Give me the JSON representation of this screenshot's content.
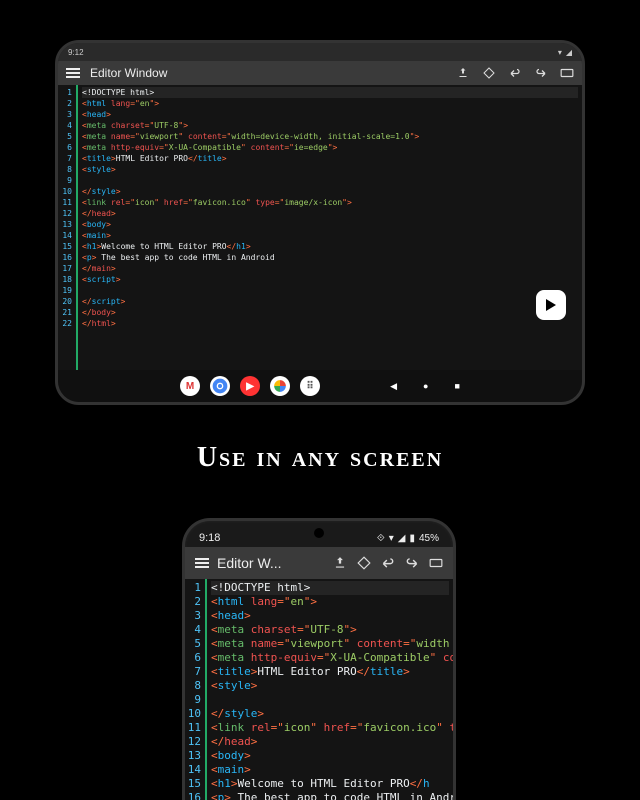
{
  "caption": "Use in any screen",
  "tablet": {
    "clock": "9:12",
    "title": "Editor Window",
    "lines": [
      [
        {
          "c": "t-doct",
          "t": "<!DOCTYPE html>"
        }
      ],
      [
        {
          "c": "t-br",
          "t": "<"
        },
        {
          "c": "t-tag",
          "t": "html"
        },
        {
          "c": "t-txt",
          "t": " "
        },
        {
          "c": "t-attr",
          "t": "lang"
        },
        {
          "c": "t-br",
          "t": "=\""
        },
        {
          "c": "t-str",
          "t": "en"
        },
        {
          "c": "t-br",
          "t": "\">"
        }
      ],
      [
        {
          "c": "t-br",
          "t": "<"
        },
        {
          "c": "t-tag",
          "t": "head"
        },
        {
          "c": "t-br",
          "t": ">"
        }
      ],
      [
        {
          "c": "t-br",
          "t": "<"
        },
        {
          "c": "t-tag2",
          "t": "meta"
        },
        {
          "c": "t-txt",
          "t": " "
        },
        {
          "c": "t-attr",
          "t": "charset"
        },
        {
          "c": "t-br",
          "t": "=\""
        },
        {
          "c": "t-str",
          "t": "UTF-8"
        },
        {
          "c": "t-br",
          "t": "\">"
        }
      ],
      [
        {
          "c": "t-br",
          "t": "<"
        },
        {
          "c": "t-tag2",
          "t": "meta"
        },
        {
          "c": "t-txt",
          "t": " "
        },
        {
          "c": "t-attr",
          "t": "name"
        },
        {
          "c": "t-br",
          "t": "=\""
        },
        {
          "c": "t-str",
          "t": "viewport"
        },
        {
          "c": "t-br",
          "t": "\" "
        },
        {
          "c": "t-attr",
          "t": "content"
        },
        {
          "c": "t-br",
          "t": "=\""
        },
        {
          "c": "t-str",
          "t": "width=device-width, initial-scale=1.0"
        },
        {
          "c": "t-br",
          "t": "\">"
        }
      ],
      [
        {
          "c": "t-br",
          "t": "<"
        },
        {
          "c": "t-tag2",
          "t": "meta"
        },
        {
          "c": "t-txt",
          "t": " "
        },
        {
          "c": "t-attr",
          "t": "http-equiv"
        },
        {
          "c": "t-br",
          "t": "=\""
        },
        {
          "c": "t-str",
          "t": "X-UA-Compatible"
        },
        {
          "c": "t-br",
          "t": "\" "
        },
        {
          "c": "t-attr",
          "t": "content"
        },
        {
          "c": "t-br",
          "t": "=\""
        },
        {
          "c": "t-str",
          "t": "ie=edge"
        },
        {
          "c": "t-br",
          "t": "\">"
        }
      ],
      [
        {
          "c": "t-br",
          "t": "<"
        },
        {
          "c": "t-tag",
          "t": "title"
        },
        {
          "c": "t-br",
          "t": ">"
        },
        {
          "c": "t-txt",
          "t": "HTML Editor PRO"
        },
        {
          "c": "t-br",
          "t": "</"
        },
        {
          "c": "t-tag",
          "t": "title"
        },
        {
          "c": "t-br",
          "t": ">"
        }
      ],
      [
        {
          "c": "t-br",
          "t": "<"
        },
        {
          "c": "t-tag",
          "t": "style"
        },
        {
          "c": "t-br",
          "t": ">"
        }
      ],
      [
        {
          "c": "t-txt",
          "t": ""
        }
      ],
      [
        {
          "c": "t-br",
          "t": "</"
        },
        {
          "c": "t-tag",
          "t": "style"
        },
        {
          "c": "t-br",
          "t": ">"
        }
      ],
      [
        {
          "c": "t-br",
          "t": "<"
        },
        {
          "c": "t-tag2",
          "t": "link"
        },
        {
          "c": "t-txt",
          "t": " "
        },
        {
          "c": "t-attr",
          "t": "rel"
        },
        {
          "c": "t-br",
          "t": "=\""
        },
        {
          "c": "t-str",
          "t": "icon"
        },
        {
          "c": "t-br",
          "t": "\" "
        },
        {
          "c": "t-attr",
          "t": "href"
        },
        {
          "c": "t-br",
          "t": "=\""
        },
        {
          "c": "t-str",
          "t": "favicon.ico"
        },
        {
          "c": "t-br",
          "t": "\" "
        },
        {
          "c": "t-attr",
          "t": "type"
        },
        {
          "c": "t-br",
          "t": "=\""
        },
        {
          "c": "t-str",
          "t": "image/x-icon"
        },
        {
          "c": "t-br",
          "t": "\">"
        }
      ],
      [
        {
          "c": "t-br",
          "t": "</"
        },
        {
          "c": "t-close",
          "t": "head"
        },
        {
          "c": "t-br",
          "t": ">"
        }
      ],
      [
        {
          "c": "t-br",
          "t": "<"
        },
        {
          "c": "t-tag",
          "t": "body"
        },
        {
          "c": "t-br",
          "t": ">"
        }
      ],
      [
        {
          "c": "t-br",
          "t": "<"
        },
        {
          "c": "t-tag",
          "t": "main"
        },
        {
          "c": "t-br",
          "t": ">"
        }
      ],
      [
        {
          "c": "t-br",
          "t": "<"
        },
        {
          "c": "t-tag",
          "t": "h1"
        },
        {
          "c": "t-br",
          "t": ">"
        },
        {
          "c": "t-txt",
          "t": "Welcome to HTML Editor PRO"
        },
        {
          "c": "t-br",
          "t": "</"
        },
        {
          "c": "t-tag",
          "t": "h1"
        },
        {
          "c": "t-br",
          "t": ">"
        }
      ],
      [
        {
          "c": "t-br",
          "t": "<"
        },
        {
          "c": "t-tag",
          "t": "p"
        },
        {
          "c": "t-br",
          "t": "> "
        },
        {
          "c": "t-txt",
          "t": "The best app to code HTML in Android"
        }
      ],
      [
        {
          "c": "t-br",
          "t": "</"
        },
        {
          "c": "t-close",
          "t": "main"
        },
        {
          "c": "t-br",
          "t": ">"
        }
      ],
      [
        {
          "c": "t-br",
          "t": "<"
        },
        {
          "c": "t-tag",
          "t": "script"
        },
        {
          "c": "t-br",
          "t": ">"
        }
      ],
      [
        {
          "c": "t-txt",
          "t": ""
        }
      ],
      [
        {
          "c": "t-br",
          "t": "</"
        },
        {
          "c": "t-tag",
          "t": "script"
        },
        {
          "c": "t-br",
          "t": ">"
        }
      ],
      [
        {
          "c": "t-br",
          "t": "</"
        },
        {
          "c": "t-close",
          "t": "body"
        },
        {
          "c": "t-br",
          "t": ">"
        }
      ],
      [
        {
          "c": "t-br",
          "t": "</"
        },
        {
          "c": "t-close",
          "t": "html"
        },
        {
          "c": "t-br",
          "t": ">"
        }
      ]
    ],
    "highlight_line": 0
  },
  "phone": {
    "clock": "9:18",
    "battery": "45%",
    "title": "Editor W...",
    "lines": [
      [
        {
          "c": "t-doct",
          "t": "<!DOCTYPE html>"
        }
      ],
      [
        {
          "c": "t-br",
          "t": "<"
        },
        {
          "c": "t-tag",
          "t": "html"
        },
        {
          "c": "t-txt",
          "t": " "
        },
        {
          "c": "t-attr",
          "t": "lang"
        },
        {
          "c": "t-br",
          "t": "=\""
        },
        {
          "c": "t-str",
          "t": "en"
        },
        {
          "c": "t-br",
          "t": "\">"
        }
      ],
      [
        {
          "c": "t-br",
          "t": "<"
        },
        {
          "c": "t-tag",
          "t": "head"
        },
        {
          "c": "t-br",
          "t": ">"
        }
      ],
      [
        {
          "c": "t-br",
          "t": "<"
        },
        {
          "c": "t-tag2",
          "t": "meta"
        },
        {
          "c": "t-txt",
          "t": " "
        },
        {
          "c": "t-attr",
          "t": "charset"
        },
        {
          "c": "t-br",
          "t": "=\""
        },
        {
          "c": "t-str",
          "t": "UTF-8"
        },
        {
          "c": "t-br",
          "t": "\">"
        }
      ],
      [
        {
          "c": "t-br",
          "t": "<"
        },
        {
          "c": "t-tag2",
          "t": "meta"
        },
        {
          "c": "t-txt",
          "t": " "
        },
        {
          "c": "t-attr",
          "t": "name"
        },
        {
          "c": "t-br",
          "t": "=\""
        },
        {
          "c": "t-str",
          "t": "viewport"
        },
        {
          "c": "t-br",
          "t": "\" "
        },
        {
          "c": "t-attr",
          "t": "content"
        },
        {
          "c": "t-br",
          "t": "=\""
        },
        {
          "c": "t-str",
          "t": "width"
        }
      ],
      [
        {
          "c": "t-br",
          "t": "<"
        },
        {
          "c": "t-tag2",
          "t": "meta"
        },
        {
          "c": "t-txt",
          "t": " "
        },
        {
          "c": "t-attr",
          "t": "http-equiv"
        },
        {
          "c": "t-br",
          "t": "=\""
        },
        {
          "c": "t-str",
          "t": "X-UA-Compatible"
        },
        {
          "c": "t-br",
          "t": "\" "
        },
        {
          "c": "t-attr",
          "t": "co"
        }
      ],
      [
        {
          "c": "t-br",
          "t": "<"
        },
        {
          "c": "t-tag",
          "t": "title"
        },
        {
          "c": "t-br",
          "t": ">"
        },
        {
          "c": "t-txt",
          "t": "HTML Editor PRO"
        },
        {
          "c": "t-br",
          "t": "</"
        },
        {
          "c": "t-tag",
          "t": "title"
        },
        {
          "c": "t-br",
          "t": ">"
        }
      ],
      [
        {
          "c": "t-br",
          "t": "<"
        },
        {
          "c": "t-tag",
          "t": "style"
        },
        {
          "c": "t-br",
          "t": ">"
        }
      ],
      [
        {
          "c": "t-txt",
          "t": ""
        }
      ],
      [
        {
          "c": "t-br",
          "t": "</"
        },
        {
          "c": "t-tag",
          "t": "style"
        },
        {
          "c": "t-br",
          "t": ">"
        }
      ],
      [
        {
          "c": "t-br",
          "t": "<"
        },
        {
          "c": "t-tag2",
          "t": "link"
        },
        {
          "c": "t-txt",
          "t": " "
        },
        {
          "c": "t-attr",
          "t": "rel"
        },
        {
          "c": "t-br",
          "t": "=\""
        },
        {
          "c": "t-str",
          "t": "icon"
        },
        {
          "c": "t-br",
          "t": "\" "
        },
        {
          "c": "t-attr",
          "t": "href"
        },
        {
          "c": "t-br",
          "t": "=\""
        },
        {
          "c": "t-str",
          "t": "favicon.ico"
        },
        {
          "c": "t-br",
          "t": "\" "
        },
        {
          "c": "t-attr",
          "t": "type"
        },
        {
          "c": "t-br",
          "t": "=\""
        },
        {
          "c": "t-str",
          "t": "i"
        }
      ],
      [
        {
          "c": "t-br",
          "t": "</"
        },
        {
          "c": "t-close",
          "t": "head"
        },
        {
          "c": "t-br",
          "t": ">"
        }
      ],
      [
        {
          "c": "t-br",
          "t": "<"
        },
        {
          "c": "t-tag",
          "t": "body"
        },
        {
          "c": "t-br",
          "t": ">"
        }
      ],
      [
        {
          "c": "t-br",
          "t": "<"
        },
        {
          "c": "t-tag",
          "t": "main"
        },
        {
          "c": "t-br",
          "t": ">"
        }
      ],
      [
        {
          "c": "t-br",
          "t": "<"
        },
        {
          "c": "t-tag",
          "t": "h1"
        },
        {
          "c": "t-br",
          "t": ">"
        },
        {
          "c": "t-txt",
          "t": "Welcome to HTML Editor PRO"
        },
        {
          "c": "t-br",
          "t": "</"
        },
        {
          "c": "t-tag",
          "t": "h"
        }
      ],
      [
        {
          "c": "t-br",
          "t": "<"
        },
        {
          "c": "t-tag",
          "t": "p"
        },
        {
          "c": "t-br",
          "t": "> "
        },
        {
          "c": "t-txt",
          "t": "The best app to code HTML in Androi"
        }
      ]
    ],
    "highlight_line": 0
  }
}
